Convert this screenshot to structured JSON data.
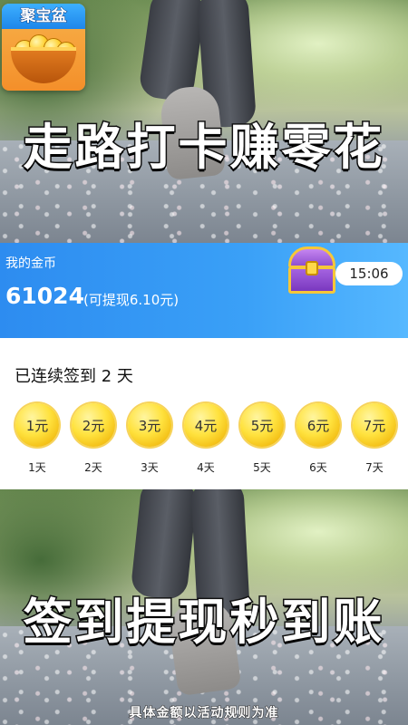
{
  "logo": {
    "title": "聚宝盆",
    "icon": "treasure-bowl-icon"
  },
  "banner_top": {
    "slogan": "走路打卡赚零花"
  },
  "coins": {
    "label": "我的金币",
    "value": "61024",
    "withdrawable": "(可提现6.10元)",
    "chest_icon": "treasure-chest-icon",
    "timer": "15:06",
    "accent": "#2d8cf0"
  },
  "signin": {
    "title": "已连续签到 2 天",
    "days": [
      {
        "reward": "1元",
        "day": "1天"
      },
      {
        "reward": "2元",
        "day": "2天"
      },
      {
        "reward": "3元",
        "day": "3天"
      },
      {
        "reward": "4元",
        "day": "4天"
      },
      {
        "reward": "5元",
        "day": "5天"
      },
      {
        "reward": "6元",
        "day": "6天"
      },
      {
        "reward": "7元",
        "day": "7天"
      }
    ]
  },
  "banner_bottom": {
    "slogan": "签到提现秒到账",
    "disclaimer": "具体金额以活动规则为准"
  }
}
